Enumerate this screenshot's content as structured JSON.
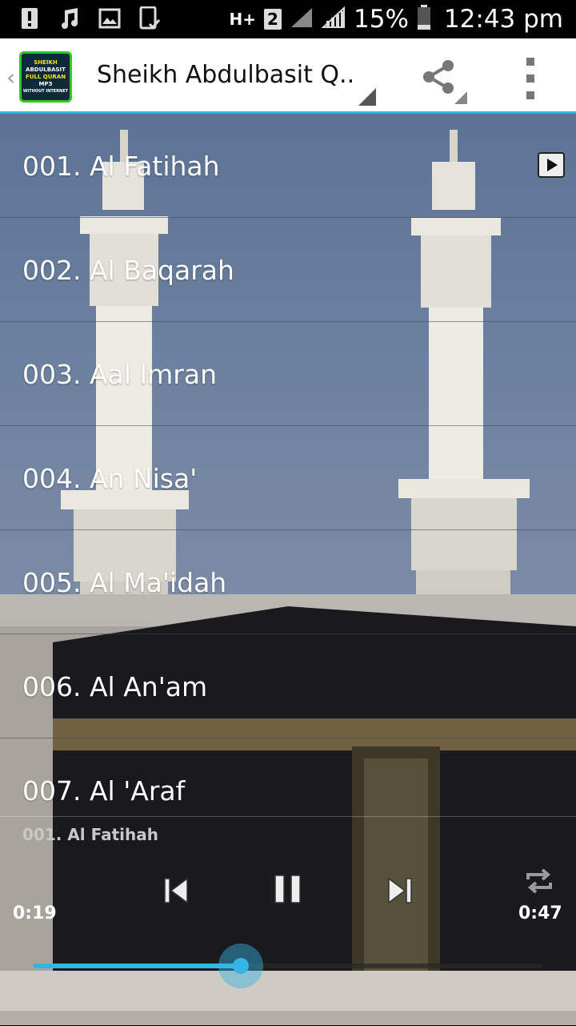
{
  "status_bar": {
    "network_type": "H+",
    "sim_slot": "2",
    "battery": "15%",
    "time": "12:43 pm",
    "icons": [
      "alert-icon",
      "music-note-icon",
      "image-icon",
      "phone-check-icon"
    ]
  },
  "action_bar": {
    "title": "Sheikh Abdulbasit Q..",
    "app_icon_lines": [
      "SHEIKH",
      "ABDULBASIT",
      "FULL QURAN",
      "MP3",
      "WITHOUT INTERNET"
    ],
    "share_icon": "share-icon",
    "overflow_icon": "overflow-menu-icon"
  },
  "tracks": [
    {
      "label": "001. Al Fatihah",
      "playing": true
    },
    {
      "label": "002. Al Baqarah"
    },
    {
      "label": "003. Aal Imran"
    },
    {
      "label": "004. An Nisa'"
    },
    {
      "label": "005. Al Ma'idah"
    },
    {
      "label": "006. Al An'am"
    },
    {
      "label": "007. Al 'Araf"
    }
  ],
  "player": {
    "now_playing": "001. Al Fatihah",
    "elapsed": "0:19",
    "duration": "0:47",
    "progress": 0.408,
    "accent_color": "#33b5e5",
    "controls": [
      "previous-icon",
      "pause-icon",
      "next-icon",
      "repeat-icon"
    ]
  }
}
